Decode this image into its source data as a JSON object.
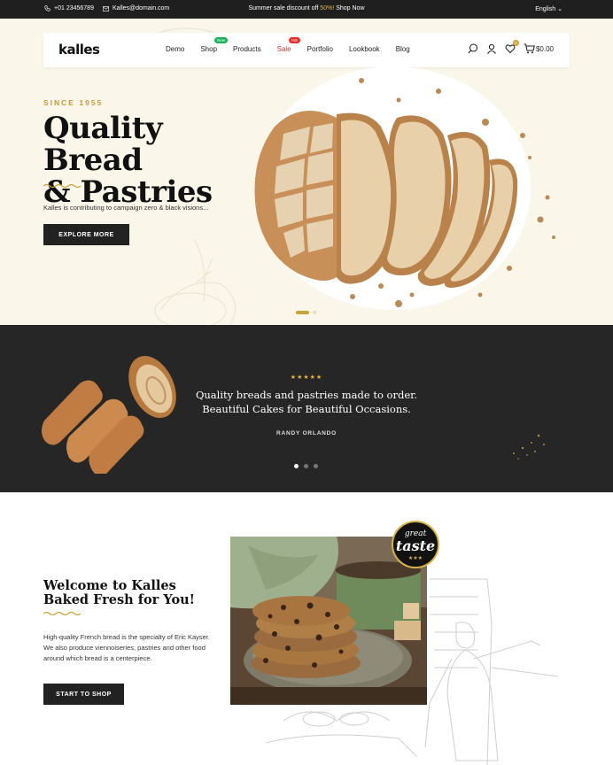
{
  "topbar": {
    "phone": "+01 23456789",
    "email": "Kalles@domain.com",
    "promo_text": "Summer sale discount off ",
    "promo_highlight": "50%!",
    "promo_link": " Shop Now",
    "language": "English"
  },
  "nav": {
    "logo": "kalles",
    "items": [
      {
        "label": "Demo"
      },
      {
        "label": "Shop",
        "badge": "New"
      },
      {
        "label": "Products"
      },
      {
        "label": "Sale",
        "badge": "Hot"
      },
      {
        "label": "Portfolio"
      },
      {
        "label": "Lookbook"
      },
      {
        "label": "Blog"
      }
    ],
    "wishlist_count": "0",
    "cart_total": "$0.00"
  },
  "hero": {
    "eyebrow": "SINCE 1955",
    "title_line1": "Quality Bread",
    "title_line2": "& Pastries",
    "subtitle": "Kalles is contributing to campaign zero & black visions...",
    "cta": "EXPLORE MORE",
    "slides_count": 2,
    "active_slide": 1
  },
  "testimonial": {
    "stars": "★★★★★",
    "quote": "Quality breads and pastries made to order. Beautiful Cakes for Beautiful Occasions.",
    "author": "RANDY ORLANDO",
    "slides_count": 3,
    "active_slide": 1
  },
  "welcome": {
    "title_line1": "Welcome to Kalles",
    "title_line2": "Baked Fresh for You!",
    "body": "High-quality French bread is the specialty of Eric Kayser. We also produce viennoiseries, pastries and other food around which bread is a centerpiece.",
    "cta": "START TO SHOP",
    "seal_line1": "great",
    "seal_line2": "taste",
    "seal_stars": "★★★"
  },
  "colors": {
    "accent_gold": "#c9a23b",
    "hero_bg": "#faf6ea",
    "dark": "#222222",
    "sale_red": "#e2312b",
    "new_green": "#1fb05a"
  }
}
